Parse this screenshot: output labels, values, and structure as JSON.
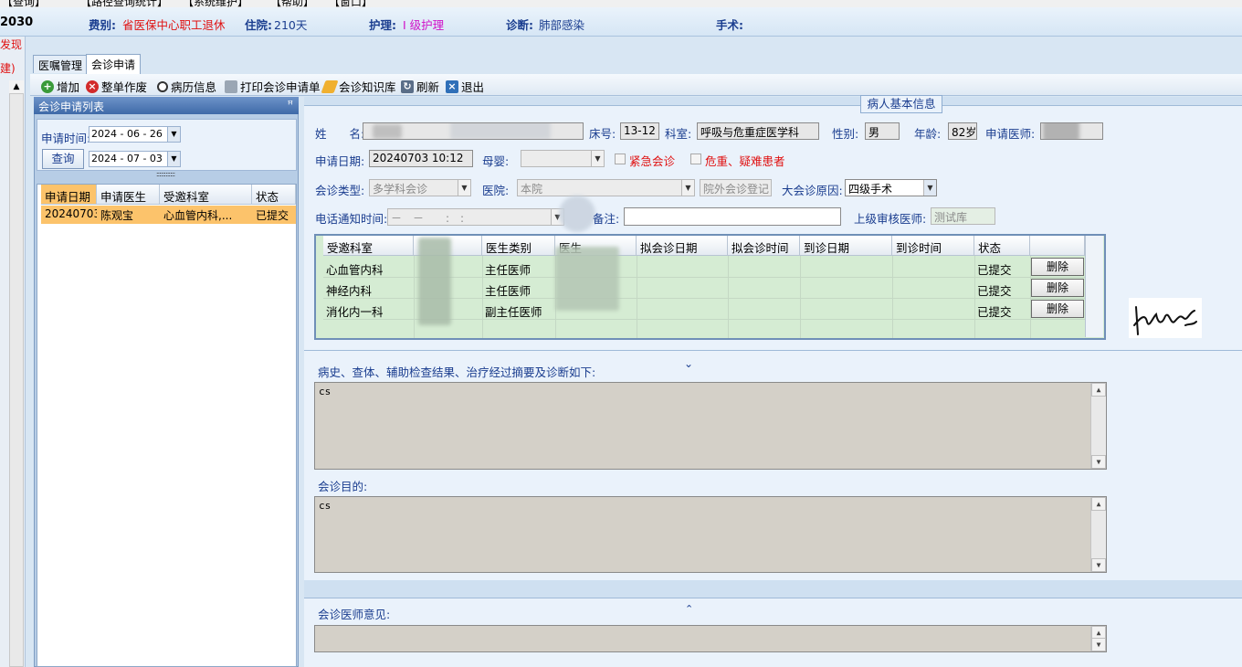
{
  "menu": {
    "items": [
      "【查询】",
      "【路径查询统计】",
      "【系统维护】",
      "【帮助】",
      "【窗口】"
    ]
  },
  "patient_bar": {
    "number": "2030",
    "fee_label": "费别:",
    "fee_value": "省医保中心职工退休",
    "stay_label": "住院:",
    "stay_value": "210天",
    "care_label": "护理:",
    "care_value": "I 级护理",
    "diag_label": "诊断:",
    "diag_value": "肺部感染",
    "surgery_label": "手术:",
    "surgery_value": ""
  },
  "left_strip": {
    "text1": "发现",
    "text2": "建)"
  },
  "tabs": [
    "医嘱管理",
    "会诊申请"
  ],
  "toolbar": {
    "add": "增加",
    "void": "整单作废",
    "record": "病历信息",
    "print": "打印会诊申请单",
    "knowledge": "会诊知识库",
    "refresh": "刷新",
    "exit": "退出"
  },
  "left_panel": {
    "title": "会诊申请列表",
    "time_label": "申请时间:",
    "date_from": "2024 - 06 - 26",
    "date_to": "2024 - 07 - 03",
    "query_button": "查询",
    "columns": [
      "申请日期",
      "申请医生",
      "受邀科室",
      "状态"
    ],
    "rows": [
      {
        "date": "20240703",
        "doctor": "陈观宝",
        "dept": "心血管内科,...",
        "status": "已提交"
      }
    ]
  },
  "patient_info": {
    "legend": "病人基本信息",
    "name_label": "姓　　名:",
    "bed_label": "床号:",
    "bed_value": "13-12",
    "dept_label": "科室:",
    "dept_value": "呼吸与危重症医学科",
    "sex_label": "性别:",
    "sex_value": "男",
    "age_label": "年龄:",
    "age_value": "82岁",
    "applicant_label": "申请医师:",
    "apply_date_label": "申请日期:",
    "apply_date_value": "20240703 10:12",
    "infant_label": "母婴:",
    "urgent_label": "紧急会诊",
    "critical_label": "危重、疑难患者",
    "type_label": "会诊类型:",
    "type_value": "多学科会诊",
    "hospital_label": "医院:",
    "hospital_value": "本院",
    "outside_button": "院外会诊登记",
    "reason_label": "大会诊原因:",
    "reason_value": "四级手术",
    "phone_label": "电话通知时间:",
    "phone_value": "－　－　　:　:",
    "remark_label": "备注:",
    "reviewer_label": "上级审核医师:",
    "reviewer_value": "测试库"
  },
  "consult_grid": {
    "columns": [
      "受邀科室",
      "",
      "医生类别",
      "医生",
      "拟会诊日期",
      "拟会诊时间",
      "到诊日期",
      "到诊时间",
      "状态",
      ""
    ],
    "rows": [
      {
        "dept": "心血管内科",
        "doc_type": "主任医师",
        "status": "已提交",
        "action": "删除"
      },
      {
        "dept": "神经内科",
        "doc_type": "主任医师",
        "status": "已提交",
        "action": "删除"
      },
      {
        "dept": "消化内一科",
        "doc_type": "副主任医师",
        "status": "已提交",
        "action": "删除"
      }
    ]
  },
  "history": {
    "label": "病史、查体、辅助检查结果、治疗经过摘要及诊断如下:",
    "value": "cs"
  },
  "purpose": {
    "label": "会诊目的:",
    "value": "cs"
  },
  "opinion": {
    "label": "会诊医师意见:",
    "value": ""
  },
  "icons": {
    "add": "plus-circle-icon",
    "void": "x-circle-icon",
    "record": "magnifier-icon",
    "print": "printer-icon",
    "knowledge": "eraser-book-icon",
    "refresh": "refresh-icon",
    "exit": "exit-icon"
  },
  "colors": {
    "accent_blue": "#1a3d8f",
    "alert_red": "#e01010",
    "care_magenta": "#d010c8",
    "selected_row": "#fcc36b",
    "grid_bg": "#d5ecd3"
  }
}
